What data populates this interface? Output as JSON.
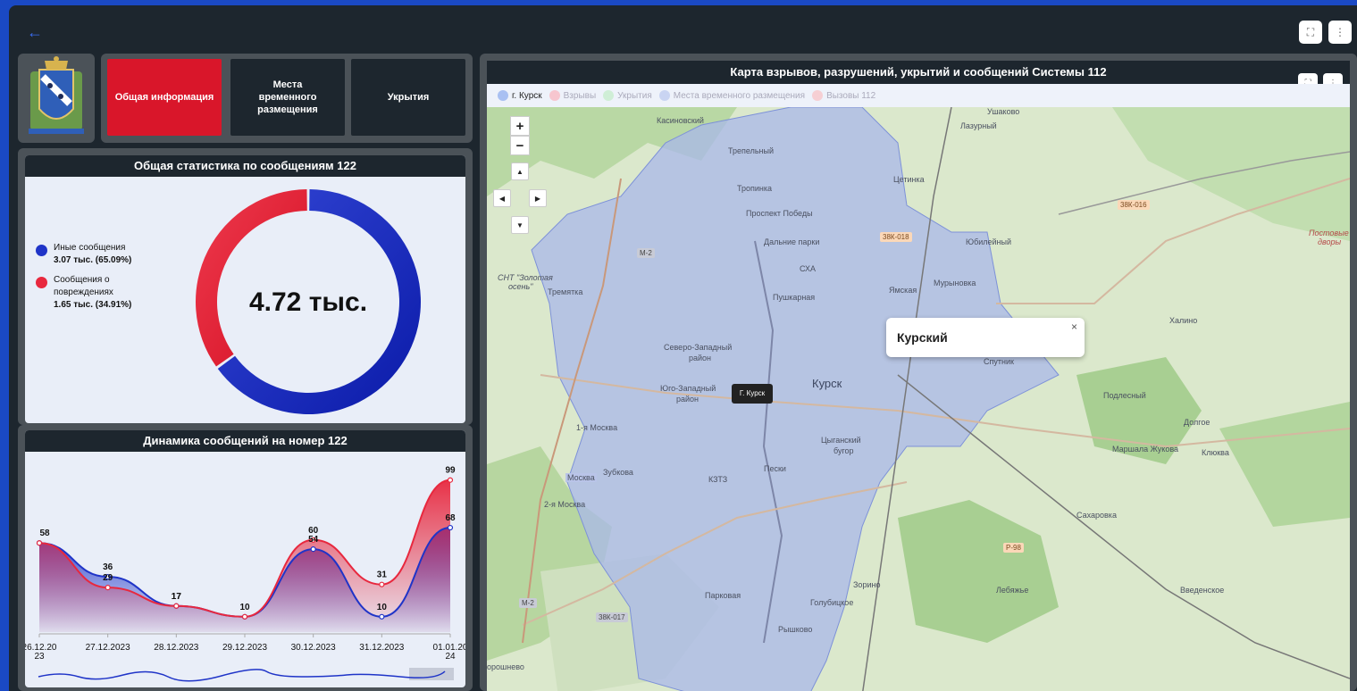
{
  "topbar": {
    "back_icon": "←",
    "fullscreen_icon": "⛶",
    "menu_icon": "⋮"
  },
  "nav": {
    "tabs": [
      {
        "label": "Общая информация",
        "active": true
      },
      {
        "label": "Места временного размещения",
        "active": false
      },
      {
        "label": "Укрытия",
        "active": false
      }
    ]
  },
  "stats": {
    "title": "Общая статистика по сообщениям 122",
    "center_label": "4.72 тыс.",
    "legend": [
      {
        "line1": "Иные сообщения",
        "line2": "3.07 тыс. (65.09%)",
        "color": "#1f34c8"
      },
      {
        "line1": "Сообщения о",
        "line2": "повреждениях",
        "line3": "1.65 тыс. (34.91%)",
        "color": "#e8283e"
      }
    ]
  },
  "dynamics": {
    "title": "Динамика сообщений на номер 122"
  },
  "chart_data": [
    {
      "type": "pie",
      "title": "Общая статистика по сообщениям 122",
      "labels": [
        "Иные сообщения",
        "Сообщения о повреждениях"
      ],
      "values": [
        3.07,
        1.65
      ],
      "percentages": [
        65.09,
        34.91
      ],
      "colors": [
        "#1f34c8",
        "#e8283e"
      ],
      "center_text": "4.72 тыс."
    },
    {
      "type": "area",
      "title": "Динамика сообщений на номер 122",
      "categories": [
        "26.12.2023",
        "27.12.2023",
        "28.12.2023",
        "29.12.2023",
        "30.12.2023",
        "31.12.2023",
        "01.01.2024"
      ],
      "category_labels": [
        [
          "26.12.20",
          "23"
        ],
        [
          "27.12.2023"
        ],
        [
          "28.12.2023"
        ],
        [
          "29.12.2023"
        ],
        [
          "30.12.2023"
        ],
        [
          "31.12.2023"
        ],
        [
          "01.01.20",
          "24"
        ]
      ],
      "series": [
        {
          "values": [
            58,
            36,
            17,
            10,
            54,
            10,
            68
          ],
          "color": "#1f34c8",
          "data_labels": [
            "58",
            "36",
            "17",
            "10",
            "54",
            "10",
            "68"
          ]
        },
        {
          "values": [
            58,
            29,
            17,
            10,
            60,
            31,
            99
          ],
          "color": "#e8283e",
          "data_labels": [
            "",
            "29",
            "17",
            "",
            "60",
            "31",
            "99"
          ]
        }
      ]
    }
  ],
  "map": {
    "title": "Карта взрывов, разрушений, укрытий и сообщений Системы 112",
    "legend": [
      {
        "label": "г. Курск",
        "color": "#a9c0f2",
        "active": true
      },
      {
        "label": "Взрывы",
        "color": "#f7c6cf",
        "active": false
      },
      {
        "label": "Укрытия",
        "color": "#cfeed6",
        "active": false
      },
      {
        "label": "Места временного размещения",
        "color": "#c9d4f2",
        "active": false
      },
      {
        "label": "Вызовы 112",
        "color": "#f6cfd3",
        "active": false
      }
    ],
    "zoom_in": "+",
    "zoom_out": "−",
    "pan_up": "▲",
    "pan_left": "◀",
    "pan_right": "▶",
    "pan_down": "▼",
    "popup_title": "Курский",
    "popup_close": "×",
    "tooltip": "Г. Курск",
    "labels": {
      "kursk": "Курск",
      "kasinovsky": "Касиновский",
      "ushakovo": "Ушаково",
      "lazurny": "Лазурный",
      "trepelny": "Трепельный",
      "tsetinka": "Цетинка",
      "tropinka": "Тропинка",
      "prospekt": "Проспект Победы",
      "dalnie": "Дальние парки",
      "sha": "СХА",
      "pushkarnaya": "Пушкарная",
      "yamskaya": "Ямская",
      "murynovka": "Мурыновка",
      "yubileyny": "Юбилейный",
      "khalino": "Халино",
      "sever": "Северо-Западный",
      "sever2": "район",
      "sputnik": "Спутник",
      "podlesny": "Подлесный",
      "dolgoe": "Долгое",
      "yugo": "Юго-Западный",
      "yugo2": "район",
      "tsygan": "Цыганский",
      "tsygan2": "бугор",
      "marshala": "Маршала Жукова",
      "klyukva": "Клюква",
      "moskva1": "1-я Москва",
      "moskva": "Москва",
      "zubkova": "Зубкова",
      "moskva2": "2-я Москва",
      "kztz": "КЗТЗ",
      "peski": "Пески",
      "sakharovka": "Сахаровка",
      "zorino": "Зорино",
      "lebyazhe": "Лебяжье",
      "vvedenskoe": "Введенское",
      "parkovaya": "Парковая",
      "golubitskoe": "Голубицкое",
      "reshkovo": "Рышково",
      "poroshnevo": "орошнево",
      "snt": "СНТ \"Золотая",
      "snt2": "осень\"",
      "tremyatka": "Тремятка",
      "postoval": "Постовые",
      "postoval2": "дворы",
      "m2": "М-2",
      "m2b": "М-2",
      "r38k018": "38К-018",
      "r38k016": "38К-016",
      "r38k017": "38К-017",
      "r98": "Р-98"
    }
  }
}
